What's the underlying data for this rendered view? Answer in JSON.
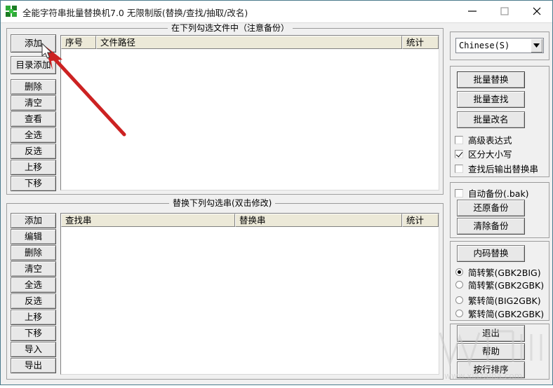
{
  "window": {
    "title": "全能字符串批量替换机7.0 无限制版(替换/查找/抽取/改名)",
    "icon": "app-puzzle-icon",
    "controls": {
      "minimize": "minimize-icon",
      "maximize": "maximize-icon",
      "close": "close-icon"
    }
  },
  "file_group": {
    "title": "在下列勾选文件中（注意备份）",
    "columns": [
      "序号",
      "文件路径",
      "统计"
    ],
    "rows": [],
    "buttons": [
      "添加",
      "目录添加",
      "删除",
      "清空",
      "查看",
      "全选",
      "反选",
      "上移",
      "下移"
    ]
  },
  "string_group": {
    "title": "替换下列勾选串(双击修改)",
    "columns": [
      "查找串",
      "替换串",
      "统计"
    ],
    "rows": [],
    "buttons": [
      "添加",
      "编辑",
      "删除",
      "清空",
      "全选",
      "反选",
      "上移",
      "下移",
      "导入",
      "导出"
    ]
  },
  "right_panel": {
    "encoding": {
      "value": "Chinese(S)",
      "arrow_icon": "chevron-down-icon"
    },
    "actions": {
      "batch_replace": "批量替换",
      "batch_find": "批量查找",
      "batch_rename": "批量改名"
    },
    "options": [
      {
        "label": "高级表达式",
        "checked": false
      },
      {
        "label": "区分大小写",
        "checked": true
      },
      {
        "label": "查找后输出替换串",
        "checked": false
      }
    ],
    "backup": {
      "auto_backup": {
        "label": "自动备份(.bak)",
        "checked": false
      },
      "restore": "还原备份",
      "clear": "清除备份"
    },
    "encoding_convert": {
      "button": "内码替换",
      "radios": [
        {
          "label": "简转繁(GBK2BIG)",
          "checked": true
        },
        {
          "label": "简转繁(GBK2GBK)",
          "checked": false
        },
        {
          "label": "繁转简(BIG2GBK)",
          "checked": false
        },
        {
          "label": "繁转简(GBK2GBK)",
          "checked": false
        }
      ]
    },
    "footer": {
      "exit": "退出",
      "help": "帮助",
      "sort": "按行排序"
    }
  },
  "annotation": {
    "arrow": "red-pointer-arrow",
    "cursor": "mouse-cursor-icon",
    "color": "#cc2222"
  },
  "watermark": {
    "text": "www.xiazaiba.com"
  }
}
